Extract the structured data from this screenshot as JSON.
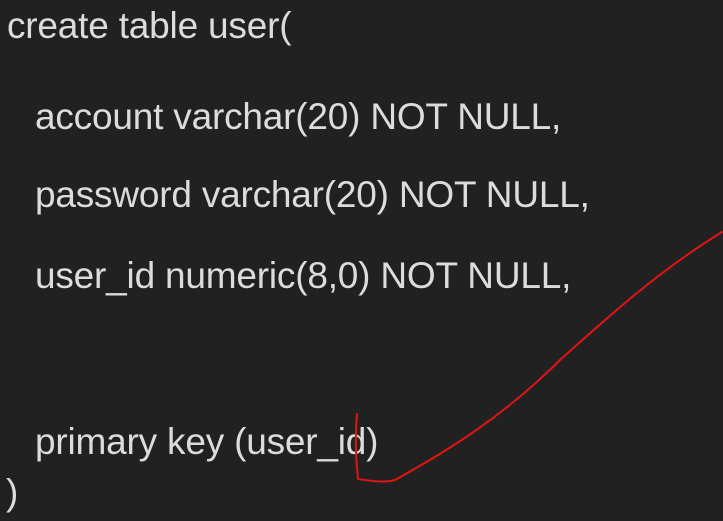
{
  "code": {
    "lines": [
      "create table user(",
      "account varchar(20) NOT NULL,",
      "password varchar(20) NOT NULL,",
      "user_id numeric(8,0) NOT NULL,",
      "",
      "primary key (user_id)",
      ")"
    ]
  },
  "annotation": {
    "stroke_color": "#e01414"
  }
}
